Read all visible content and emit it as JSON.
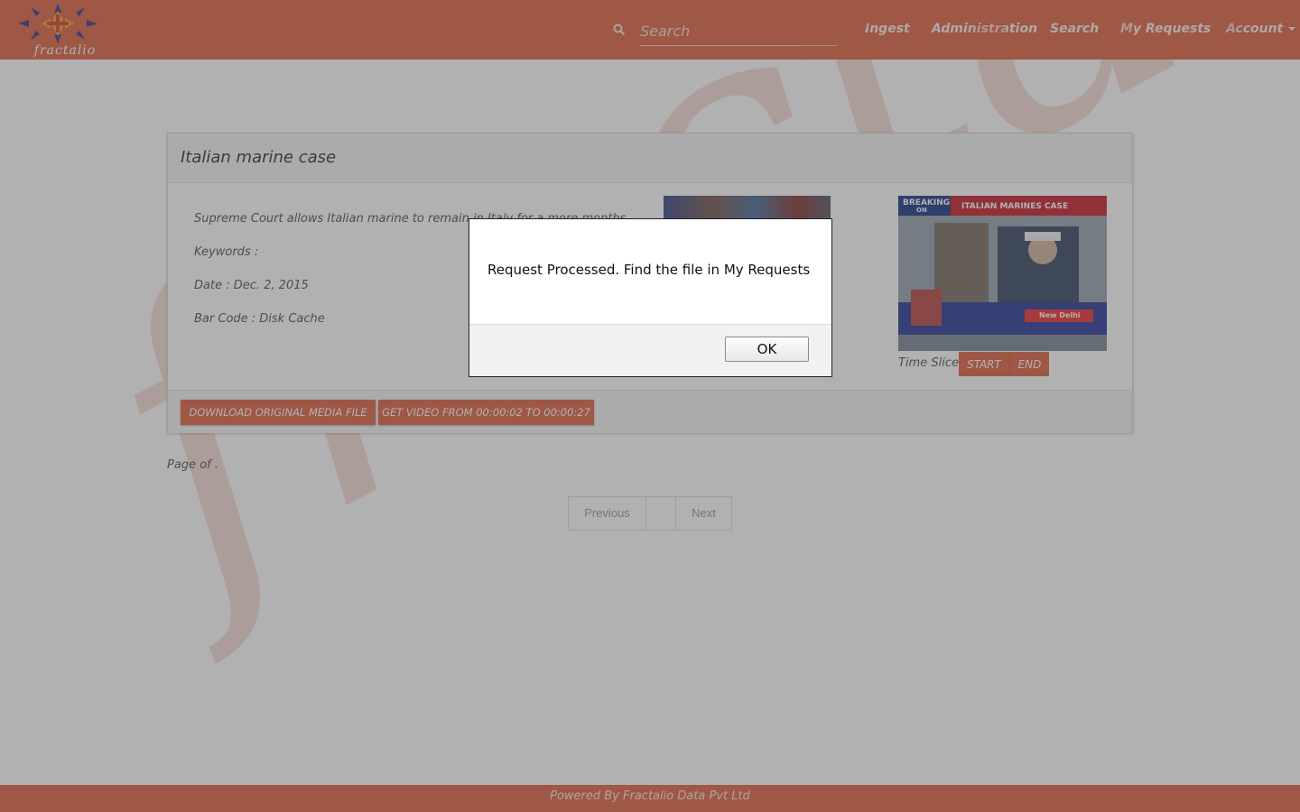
{
  "brand": {
    "logo_text": "fractalio",
    "watermark_text": "fractalio",
    "accent_color": "#e06448"
  },
  "nav": {
    "search_placeholder": "Search",
    "search_icon": "search-icon",
    "links": [
      "Ingest",
      "Administration",
      "Search",
      "My Requests",
      "Account"
    ]
  },
  "panel": {
    "title": "Italian marine case",
    "description": "Supreme Court allows Italian marine to remain in Italy for a more months",
    "keywords": "Keywords :",
    "date": "Date : Dec. 2, 2015",
    "barcode": "Bar Code : Disk Cache",
    "thumbnail_banner": "BREAKING",
    "thumbnail_banner_sub": "ON",
    "thumbnail_title": "ITALIAN MARINES CASE",
    "thumbnail_location": "New Delhi",
    "time_slice_label": "Time Slice",
    "start_label": "START",
    "end_label": "END",
    "download_label": "DOWNLOAD ORIGINAL MEDIA FILE",
    "get_video_label": "GET VIDEO FROM 00:00:02 TO 00:00:27"
  },
  "pagination": {
    "page_of": "Page of .",
    "previous": "Previous",
    "next": "Next"
  },
  "footer": {
    "text": "Powered By Fractalio Data Pvt Ltd"
  },
  "dialog": {
    "message": "Request Processed. Find the file in My Requests",
    "ok_label": "OK"
  }
}
